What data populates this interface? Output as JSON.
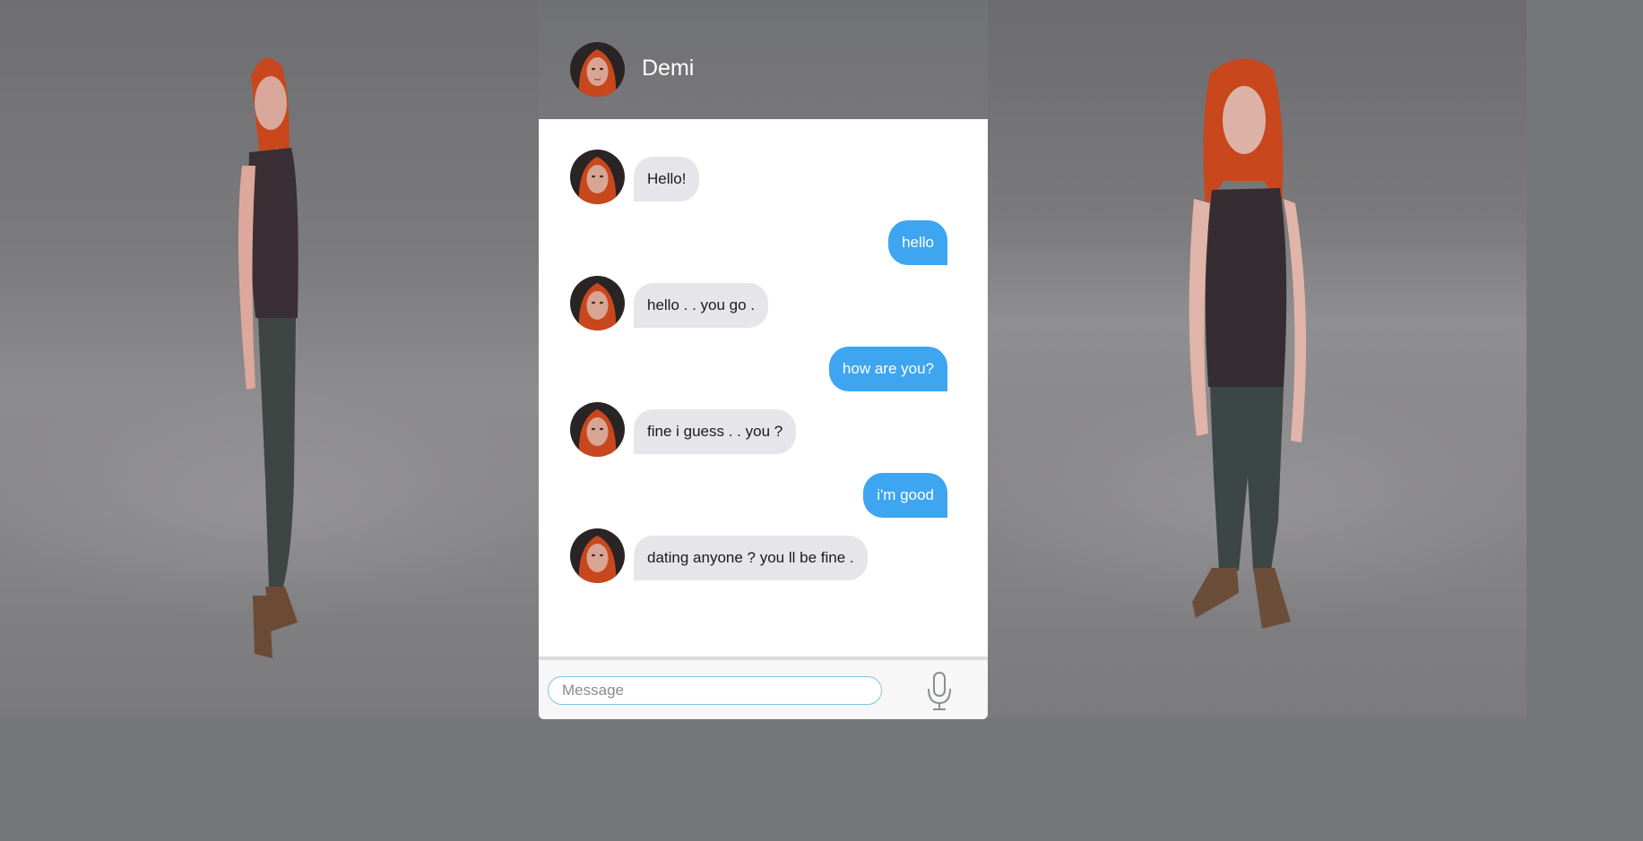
{
  "contact": {
    "name": "Demi"
  },
  "composer": {
    "placeholder": "Message",
    "mic_icon": "microphone-icon"
  },
  "messages": [
    {
      "from": "them",
      "text": "Hello!"
    },
    {
      "from": "me",
      "text": "hello"
    },
    {
      "from": "them",
      "text": "hello . . you go ."
    },
    {
      "from": "me",
      "text": "how are you?"
    },
    {
      "from": "them",
      "text": "fine i guess . . you ?"
    },
    {
      "from": "me",
      "text": "i'm good"
    },
    {
      "from": "them",
      "text": "dating anyone ? you ll be fine ."
    }
  ],
  "colors": {
    "outgoing_bubble": "#3ea5f0",
    "incoming_bubble": "#e6e6ea",
    "header_bg": "#727376",
    "page_bg": "#74777a",
    "hair": "#c8471c"
  }
}
